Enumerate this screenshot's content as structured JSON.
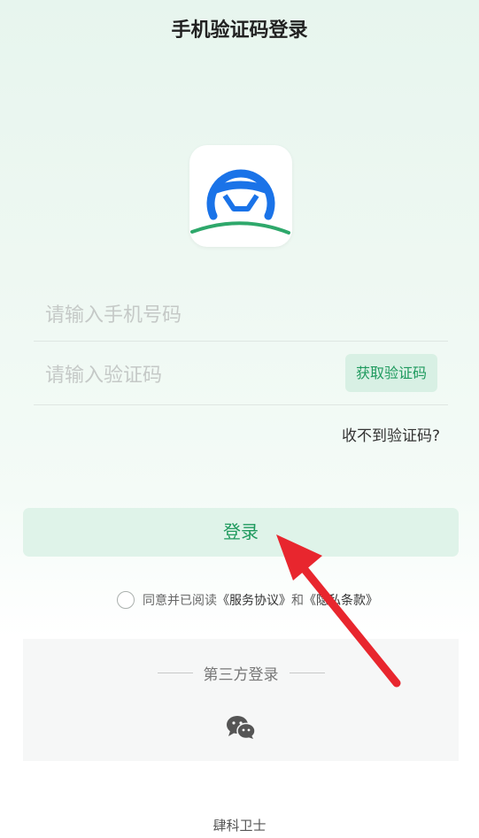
{
  "header": {
    "title": "手机验证码登录"
  },
  "form": {
    "phone_placeholder": "请输入手机号码",
    "code_placeholder": "请输入验证码",
    "get_code_label": "获取验证码",
    "no_code_link": "收不到验证码?",
    "login_label": "登录"
  },
  "agreement": {
    "prefix": "同意并已阅读",
    "service_link": "《服务协议》",
    "and": "和",
    "privacy_link": "《隐私条款》"
  },
  "third_party": {
    "title": "第三方登录",
    "icons": [
      "wechat-icon"
    ]
  },
  "footer": {
    "brand": "肆科卫士"
  },
  "colors": {
    "accent": "#1f9a5e",
    "accent_bg": "#dff3e9",
    "logo_blue": "#1a73e8",
    "logo_green": "#2ea86b",
    "annotation_arrow": "#e8262e"
  }
}
